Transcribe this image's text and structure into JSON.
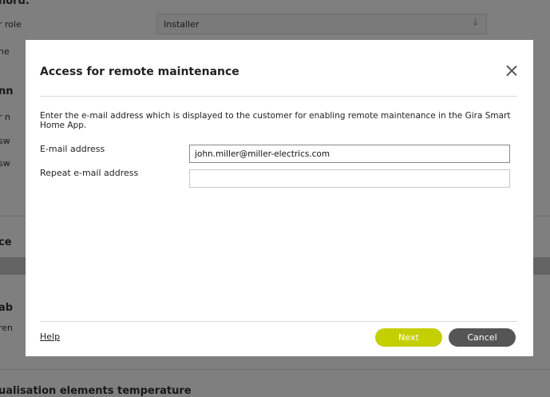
{
  "background": {
    "top_heading": "hord.",
    "user_role_label": "r role",
    "user_role_value": "Installer",
    "line2_label": "ne",
    "section2_heading": "nn",
    "section2_line1": "r n",
    "section2_line2": "sw",
    "section2_line3": "sw",
    "section3_heading": "ce",
    "section4_heading": "ab",
    "section4_line1": "ren",
    "bottom_heading": "ualisation elements temperature"
  },
  "modal": {
    "title": "Access for remote maintenance",
    "description": "Enter the e-mail address which is displayed to the customer for enabling remote maintenance in the Gira Smart Home App.",
    "email_label": "E-mail address",
    "email_value": "john.miller@miller-electrics.com",
    "repeat_email_label": "Repeat e-mail address",
    "repeat_email_value": "",
    "help_label": "Help",
    "next_label": "Next",
    "cancel_label": "Cancel",
    "close_icon": "close-icon"
  },
  "colors": {
    "next_button": "#c4cf00",
    "cancel_button": "#555555",
    "overlay": "rgba(0,0,0,0.5)"
  }
}
